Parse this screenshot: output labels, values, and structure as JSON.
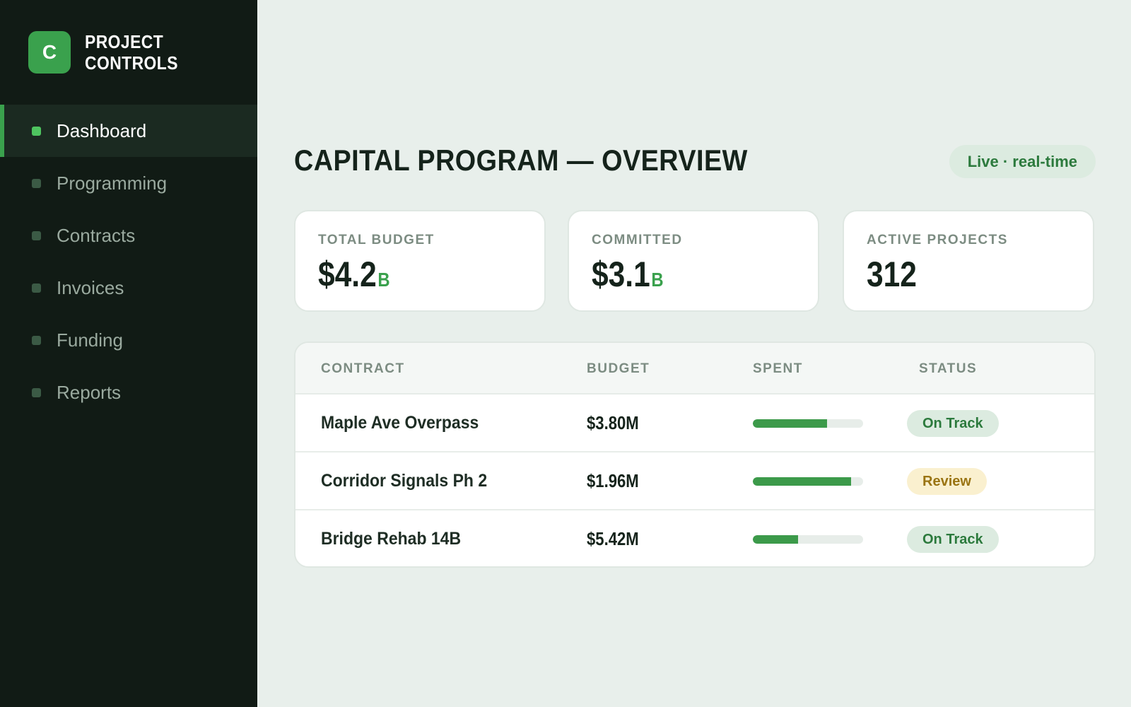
{
  "brand": {
    "logo_letter": "C",
    "line1": "PROJECT",
    "line2": "CONTROLS",
    "accent_color": "#3aa14d"
  },
  "sidebar": {
    "items": [
      {
        "label": "Dashboard",
        "active": true
      },
      {
        "label": "Programming",
        "active": false
      },
      {
        "label": "Contracts",
        "active": false
      },
      {
        "label": "Invoices",
        "active": false
      },
      {
        "label": "Funding",
        "active": false
      },
      {
        "label": "Reports",
        "active": false
      }
    ]
  },
  "header": {
    "title": "CAPITAL PROGRAM — OVERVIEW",
    "live_label": "Live · real-time"
  },
  "cards": [
    {
      "label": "TOTAL BUDGET",
      "value": "$4.2",
      "unit": "B"
    },
    {
      "label": "COMMITTED",
      "value": "$3.1",
      "unit": "B"
    },
    {
      "label": "ACTIVE PROJECTS",
      "value": "312",
      "unit": ""
    }
  ],
  "table": {
    "headers": [
      "CONTRACT",
      "BUDGET",
      "SPENT",
      "STATUS"
    ],
    "rows": [
      {
        "contract": "Maple Ave Overpass",
        "budget": "$3.80M",
        "spent_pct": 67,
        "status": "On Track",
        "status_kind": "ok"
      },
      {
        "contract": "Corridor Signals Ph 2",
        "budget": "$1.96M",
        "spent_pct": 89,
        "status": "Review",
        "status_kind": "review"
      },
      {
        "contract": "Bridge Rehab 14B",
        "budget": "$5.42M",
        "spent_pct": 41,
        "status": "On Track",
        "status_kind": "ok"
      }
    ]
  }
}
